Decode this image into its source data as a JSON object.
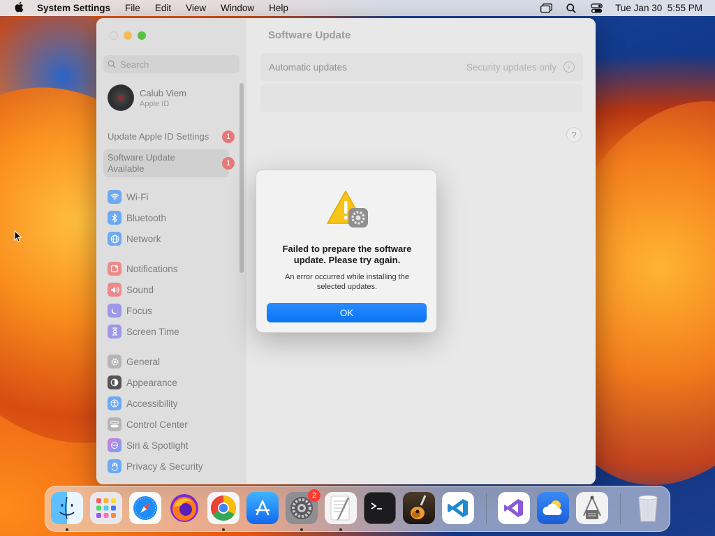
{
  "menubar": {
    "app_name": "System Settings",
    "menus": [
      "File",
      "Edit",
      "View",
      "Window",
      "Help"
    ],
    "clock": "Tue Jan 30  5:55 PM"
  },
  "window": {
    "title": "Software Update",
    "search_placeholder": "Search",
    "account": {
      "name": "Calub Viem",
      "subtitle": "Apple ID"
    },
    "notices": [
      {
        "label": "Update Apple ID Settings",
        "badge": "1"
      },
      {
        "label": "Software Update Available",
        "badge": "1"
      }
    ],
    "sidebar_items": [
      {
        "label": "Wi-Fi",
        "icon": "wifi-icon",
        "color": "#3b8ff0"
      },
      {
        "label": "Bluetooth",
        "icon": "bluetooth-icon",
        "color": "#3b8ff0"
      },
      {
        "label": "Network",
        "icon": "globe-icon",
        "color": "#3b8ff0"
      },
      {
        "label": "Notifications",
        "icon": "bell-icon",
        "color": "#e84a4a"
      },
      {
        "label": "Sound",
        "icon": "speaker-icon",
        "color": "#e84a4a"
      },
      {
        "label": "Focus",
        "icon": "moon-icon",
        "color": "#5a4fd6"
      },
      {
        "label": "Screen Time",
        "icon": "hourglass-icon",
        "color": "#5a4fd6"
      },
      {
        "label": "General",
        "icon": "gear-icon",
        "color": "#8e8e8e"
      },
      {
        "label": "Appearance",
        "icon": "appearance-icon",
        "color": "#1c1c1c"
      },
      {
        "label": "Accessibility",
        "icon": "accessibility-icon",
        "color": "#3b8ff0"
      },
      {
        "label": "Control Center",
        "icon": "control-center-icon",
        "color": "#8e8e8e"
      },
      {
        "label": "Siri & Spotlight",
        "icon": "siri-icon",
        "color": "#c43ad6"
      },
      {
        "label": "Privacy & Security",
        "icon": "hand-icon",
        "color": "#3b8ff0"
      }
    ],
    "automatic_updates": {
      "label": "Automatic updates",
      "value": "Security updates only"
    },
    "help": "?"
  },
  "dialog": {
    "title": "Failed to prepare the software update. Please try again.",
    "message": "An error occurred while installing the selected updates.",
    "ok_label": "OK"
  },
  "dock": {
    "apps": [
      "Finder",
      "Launchpad",
      "Safari",
      "Firefox",
      "Chrome",
      "App Store",
      "System Settings",
      "TextEdit",
      "Terminal",
      "GarageBand",
      "Visual Studio Code",
      "Visual Studio",
      "Weather",
      "Disk Utility",
      "Trash"
    ],
    "system_settings_badge": "2"
  }
}
